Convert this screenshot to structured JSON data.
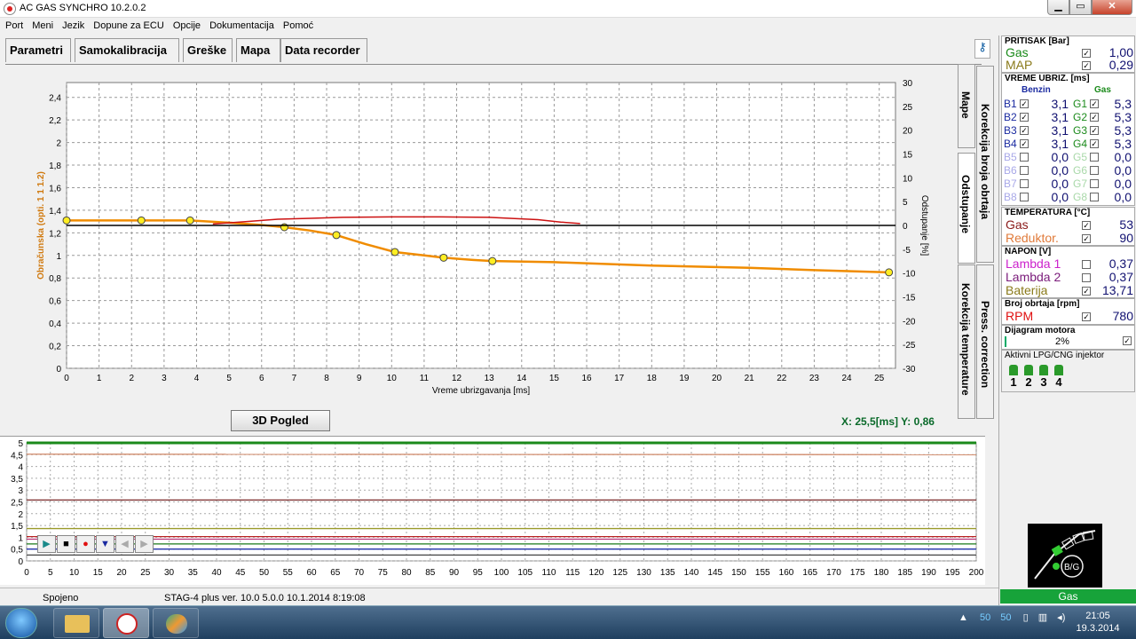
{
  "window": {
    "title": "AC GAS SYNCHRO  10.2.0.2",
    "min": "▁",
    "max": "▭",
    "close": "✕"
  },
  "menu": [
    "Port",
    "Meni",
    "Jezik",
    "Dopune za ECU",
    "Opcije",
    "Dokumentacija",
    "Pomoć"
  ],
  "tabs": [
    "Parametri",
    "Samokalibracija",
    "Greške",
    "Mapa",
    "Data recorder"
  ],
  "active_tab": "Mapa",
  "side_tabs": [
    "Mape",
    "Korekcija broja obrtaja",
    "Odstupanje",
    "Korekcija temperature",
    "Press. correction"
  ],
  "chart_data": [
    {
      "type": "line",
      "xlabel": "Vreme ubrizgavanja [ms]",
      "ylabel": "Obračunska (opti. 1 1 1.2)",
      "y2label": "Odstupanje [%]",
      "xlim": [
        0,
        25.5
      ],
      "ylim": [
        0,
        2.5
      ],
      "y2lim": [
        -30,
        30
      ],
      "xticks": [
        "0",
        "1",
        "2",
        "3",
        "4",
        "5",
        "6",
        "7",
        "8",
        "9",
        "10",
        "11",
        "12",
        "13",
        "14",
        "15",
        "16",
        "17",
        "18",
        "19",
        "20",
        "21",
        "22",
        "23",
        "24",
        "25"
      ],
      "yticks": [
        "0",
        "0,2",
        "0,4",
        "0,6",
        "0,8",
        "1",
        "1,2",
        "1,4",
        "1,6",
        "1,8",
        "2",
        "2,2",
        "2,4"
      ],
      "y2ticks": [
        "30",
        "25",
        "20",
        "15",
        "10",
        "5",
        "0",
        "-5",
        "-10",
        "-15",
        "-20",
        "-25",
        "-30"
      ],
      "grid": true,
      "series": [
        {
          "color": "#f08c00",
          "axis": "left",
          "x": [
            0,
            1.5,
            2.3,
            3.8,
            5.0,
            6.0,
            6.7,
            7.5,
            8.3,
            9.2,
            10.1,
            11.0,
            11.6,
            12.5,
            13.1,
            15.0,
            18.0,
            21.0,
            23.0,
            25.3
          ],
          "y": [
            1.31,
            1.31,
            1.31,
            1.31,
            1.29,
            1.27,
            1.25,
            1.22,
            1.18,
            1.1,
            1.03,
            1.0,
            0.98,
            0.96,
            0.95,
            0.94,
            0.91,
            0.89,
            0.87,
            0.85
          ],
          "markers_x": [
            0,
            2.3,
            3.8,
            6.7,
            8.3,
            10.1,
            11.6,
            13.1,
            25.3
          ],
          "markers_y": [
            1.31,
            1.31,
            1.31,
            1.25,
            1.18,
            1.03,
            0.98,
            0.95,
            0.85
          ]
        },
        {
          "color": "#cc1111",
          "axis": "right",
          "x": [
            4.5,
            5.5,
            6.5,
            7.5,
            8.5,
            10,
            11.5,
            13,
            14.5,
            15.2,
            15.8
          ],
          "y": [
            0.3,
            0.8,
            1.3,
            1.5,
            1.7,
            1.8,
            1.8,
            1.7,
            1.2,
            0.7,
            0.4
          ]
        },
        {
          "color": "#000000",
          "axis": "right",
          "x": [
            0,
            25.5
          ],
          "y": [
            0,
            0
          ]
        }
      ]
    },
    {
      "type": "line",
      "xlim": [
        0,
        200
      ],
      "ylim": [
        0,
        5
      ],
      "xticks": [
        "0",
        "5",
        "10",
        "15",
        "20",
        "25",
        "30",
        "35",
        "40",
        "45",
        "50",
        "55",
        "60",
        "65",
        "70",
        "75",
        "80",
        "85",
        "90",
        "95",
        "100",
        "105",
        "110",
        "115",
        "120",
        "125",
        "130",
        "135",
        "140",
        "145",
        "150",
        "155",
        "160",
        "165",
        "170",
        "175",
        "180",
        "185",
        "190",
        "195",
        "200"
      ],
      "yticks": [
        "0",
        "0,5",
        "1",
        "1,5",
        "2",
        "2,5",
        "3",
        "3,5",
        "4",
        "4,5",
        "5"
      ],
      "grid": true,
      "series": [
        {
          "color": "#1a8a1a",
          "y": [
            5,
            5
          ]
        },
        {
          "color": "#d08a6a",
          "y": [
            4.52,
            4.5
          ]
        },
        {
          "color": "#7a2a2a",
          "y": [
            2.58,
            2.58
          ]
        },
        {
          "color": "#9a9a2a",
          "y": [
            1.37,
            1.37
          ]
        },
        {
          "color": "#bb2222",
          "y": [
            1.03,
            1.03
          ]
        },
        {
          "color": "#bb3377",
          "y": [
            0.92,
            0.92
          ]
        },
        {
          "color": "#1a7a1a",
          "y": [
            0.72,
            0.72
          ]
        },
        {
          "color": "#2233aa",
          "y": [
            0.5,
            0.5
          ]
        },
        {
          "color": "#444444",
          "y": [
            0.25,
            0.25
          ]
        }
      ]
    }
  ],
  "coords": {
    "x": "X: 25,5[ms]",
    "y": "Y: 0,86"
  },
  "btn_3d": "3D Pogled",
  "player": [
    "▶",
    "■",
    "●",
    "▼",
    "◀",
    "▶"
  ],
  "status": {
    "conn": "Spojeno",
    "ver": "STAG-4 plus   ver. 10.0  5.0.0    10.1.2014  8:19:08"
  },
  "panel": {
    "pritisak": {
      "title": "PRITISAK [Bar]",
      "rows": [
        {
          "label": "Gas",
          "value": "1,00",
          "color": "#1a8a1a"
        },
        {
          "label": "MAP",
          "value": "0,29",
          "color": "#8a7a1a"
        }
      ]
    },
    "vreme": {
      "title": "VREME UBRIZ. [ms]",
      "benzin": "Benzin",
      "gas": "Gas",
      "b": [
        {
          "l": "B1",
          "v": "3,1",
          "on": true
        },
        {
          "l": "B2",
          "v": "3,1",
          "on": true
        },
        {
          "l": "B3",
          "v": "3,1",
          "on": true
        },
        {
          "l": "B4",
          "v": "3,1",
          "on": true
        },
        {
          "l": "B5",
          "v": "0,0",
          "on": false
        },
        {
          "l": "B6",
          "v": "0,0",
          "on": false
        },
        {
          "l": "B7",
          "v": "0,0",
          "on": false
        },
        {
          "l": "B8",
          "v": "0,0",
          "on": false
        }
      ],
      "g": [
        {
          "l": "G1",
          "v": "5,3",
          "on": true
        },
        {
          "l": "G2",
          "v": "5,3",
          "on": true
        },
        {
          "l": "G3",
          "v": "5,3",
          "on": true
        },
        {
          "l": "G4",
          "v": "5,3",
          "on": true
        },
        {
          "l": "G5",
          "v": "0,0",
          "on": false
        },
        {
          "l": "G6",
          "v": "0,0",
          "on": false
        },
        {
          "l": "G7",
          "v": "0,0",
          "on": false
        },
        {
          "l": "G8",
          "v": "0,0",
          "on": false
        }
      ]
    },
    "temperatura": {
      "title": "TEMPERATURA [°C]",
      "rows": [
        {
          "label": "Gas",
          "value": "53",
          "color": "#8a1a1a"
        },
        {
          "label": "Reduktor.",
          "value": "90",
          "color": "#e07a3a"
        }
      ]
    },
    "napon": {
      "title": "NAPON [V]",
      "rows": [
        {
          "label": "Lambda 1",
          "value": "0,37",
          "color": "#cc22cc",
          "on": false
        },
        {
          "label": "Lambda 2",
          "value": "0,37",
          "color": "#7a1a7a",
          "on": false
        },
        {
          "label": "Baterija",
          "value": "13,71",
          "color": "#8a7a1a",
          "on": true
        }
      ]
    },
    "obrtaji": {
      "title": "Broj obrtaja [rpm]",
      "label": "RPM",
      "value": "780",
      "color": "#e01010"
    },
    "dijagram": {
      "title": "Dijagram motora",
      "value": "2%"
    },
    "aktivni": {
      "title": "Aktivni LPG/CNG injektor",
      "items": [
        "1",
        "2",
        "3",
        "4"
      ]
    }
  },
  "logo_text": "B/G",
  "gas_label": "Gas",
  "tray": {
    "a": "50",
    "b": "50"
  },
  "clock": {
    "time": "21:05",
    "date": "19.3.2014"
  }
}
